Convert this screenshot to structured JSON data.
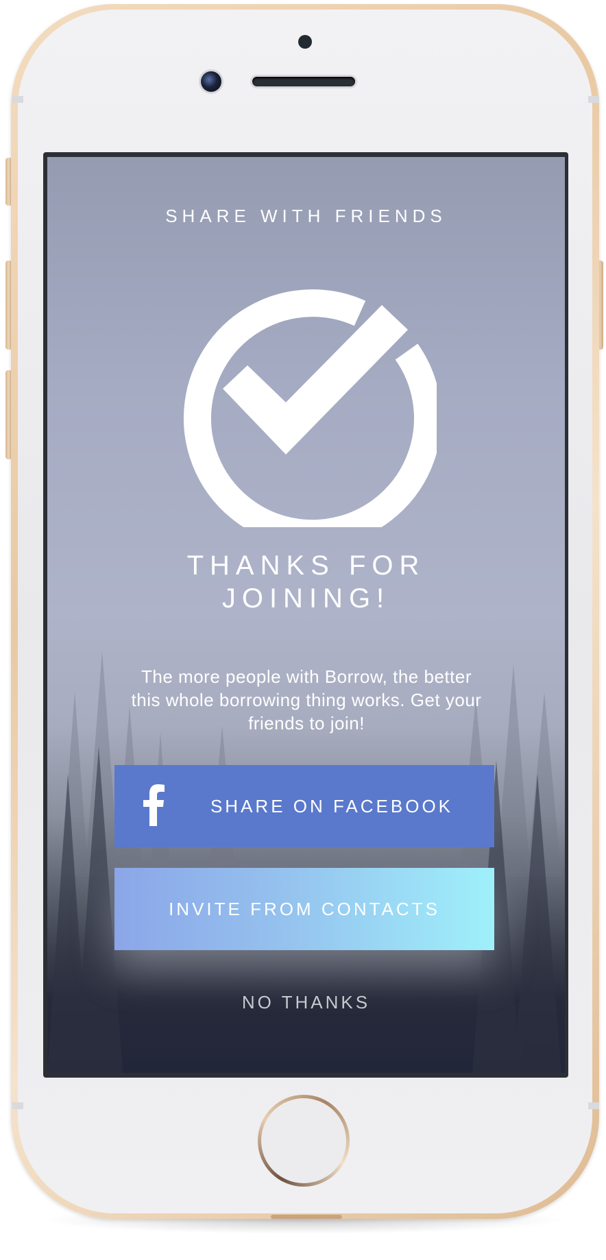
{
  "screen": {
    "header_title": "SHARE WITH FRIENDS",
    "success_icon": "check-circle-icon",
    "thanks_title": "THANKS FOR JOINING!",
    "description": "The more people with Borrow, the better this whole borrowing thing works. Get your friends to join!"
  },
  "actions": {
    "facebook": {
      "label": "SHARE ON FACEBOOK",
      "icon": "facebook-icon",
      "color": "#5a79cc"
    },
    "invite": {
      "label": "INVITE FROM CONTACTS",
      "gradient_start": "#8ba6e8",
      "gradient_end": "#9ff0fb"
    },
    "dismiss": {
      "label": "NO THANKS"
    }
  },
  "device": {
    "model": "iphone",
    "finish_color": "#e9c9a3"
  }
}
